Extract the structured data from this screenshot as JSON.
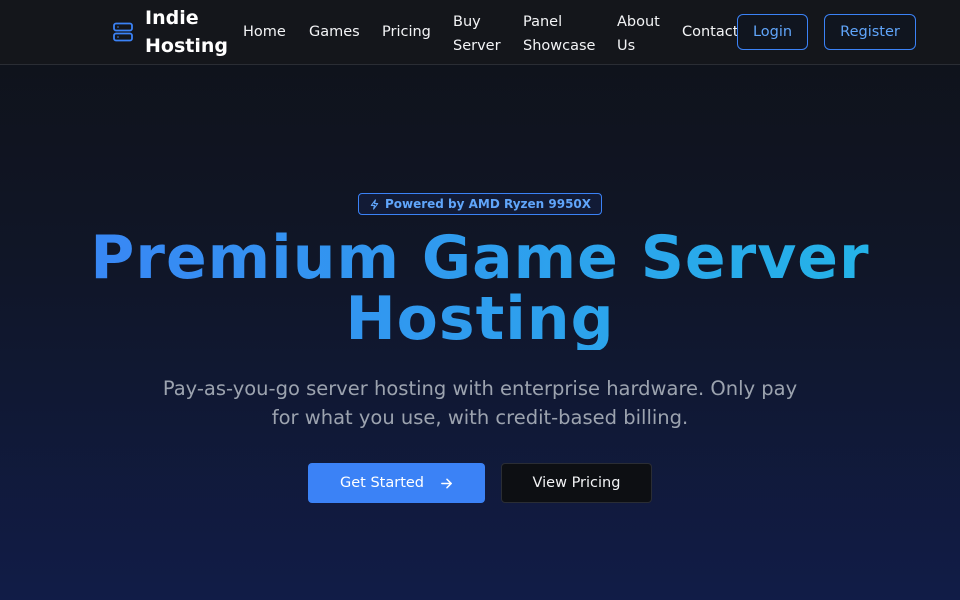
{
  "brand": {
    "name": "Indie Hosting",
    "icon": "server-icon"
  },
  "nav": {
    "links": [
      {
        "label": "Home"
      },
      {
        "label": "Games"
      },
      {
        "label": "Pricing"
      },
      {
        "label": "Buy Server"
      },
      {
        "label": "Panel Showcase"
      },
      {
        "label": "About Us"
      },
      {
        "label": "Contact"
      }
    ],
    "login_label": "Login",
    "register_label": "Register"
  },
  "hero": {
    "badge": {
      "icon": "lightning-icon",
      "label": "Powered by AMD Ryzen 9950X"
    },
    "title": "Premium Game Server Hosting",
    "subtitle": "Pay-as-you-go server hosting with enterprise hardware. Only pay for what you use, with credit-based billing.",
    "primary_cta": {
      "label": "Get Started",
      "icon": "arrow-right-icon"
    },
    "secondary_cta": {
      "label": "View Pricing"
    }
  },
  "colors": {
    "accent": "#3b82f6",
    "accent_light": "#60a5fa",
    "gradient_end": "#22b8e6",
    "nav_background": "#14161b",
    "subtitle_text": "#9ca3af"
  }
}
